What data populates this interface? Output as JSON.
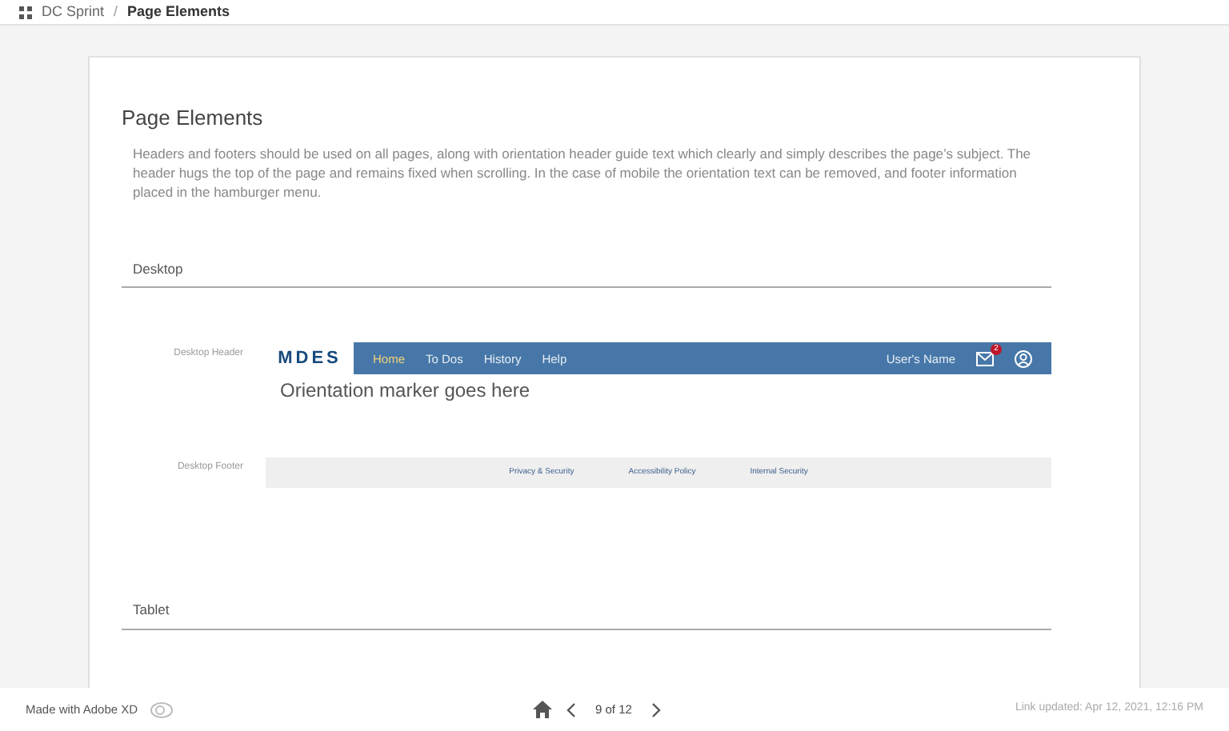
{
  "breadcrumb": {
    "project": "DC Sprint",
    "separator": "/",
    "page": "Page Elements"
  },
  "card": {
    "title": "Page Elements",
    "description": "Headers and footers should be used on all pages, along with orientation header guide text which clearly and simply describes the page’s subject. The header hugs the top of the page and remains fixed when scrolling. In the case of mobile the orientation text can be removed, and footer information placed in the hamburger menu.",
    "sections": [
      {
        "heading": "Desktop",
        "header_example": {
          "label": "Desktop Header",
          "logo": "MDES",
          "nav": [
            {
              "label": "Home",
              "selected": true
            },
            {
              "label": "To Dos",
              "selected": false
            },
            {
              "label": "History",
              "selected": false
            },
            {
              "label": "Help",
              "selected": false
            }
          ],
          "user_name": "User's Name",
          "mail_badge": "2",
          "orientation": "Orientation marker goes here"
        },
        "footer_example": {
          "label": "Desktop Footer",
          "links": [
            "Privacy & Security",
            "Accessibility Policy",
            "Internal Security"
          ]
        }
      },
      {
        "heading": "Tablet"
      }
    ]
  },
  "bottom_bar": {
    "made_with": "Made with Adobe XD",
    "page_indicator": "9 of 12",
    "link_updated": "Link updated: Apr 12, 2021, 12:16 PM"
  }
}
